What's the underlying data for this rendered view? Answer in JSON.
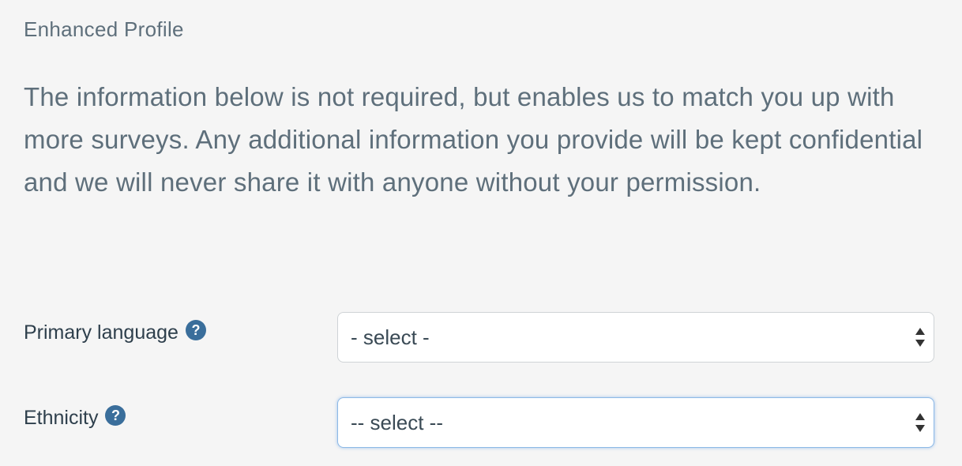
{
  "section_title": "Enhanced Profile",
  "intro_text": "The information below is not required, but enables us to match you up with more surveys. Any additional information you provide will be kept confidential and we will never share it with anyone without your permission.",
  "fields": [
    {
      "label": "Primary language",
      "help_icon": "?",
      "selected": "- select -"
    },
    {
      "label": "Ethnicity",
      "help_icon": "?",
      "selected": "-- select --"
    }
  ],
  "colors": {
    "background": "#f5f5f5",
    "text_muted": "#5e6f7b",
    "label_text": "#2e3f4c",
    "help_icon_bg": "#3a6e9b",
    "focus_border": "#8db9e6"
  }
}
